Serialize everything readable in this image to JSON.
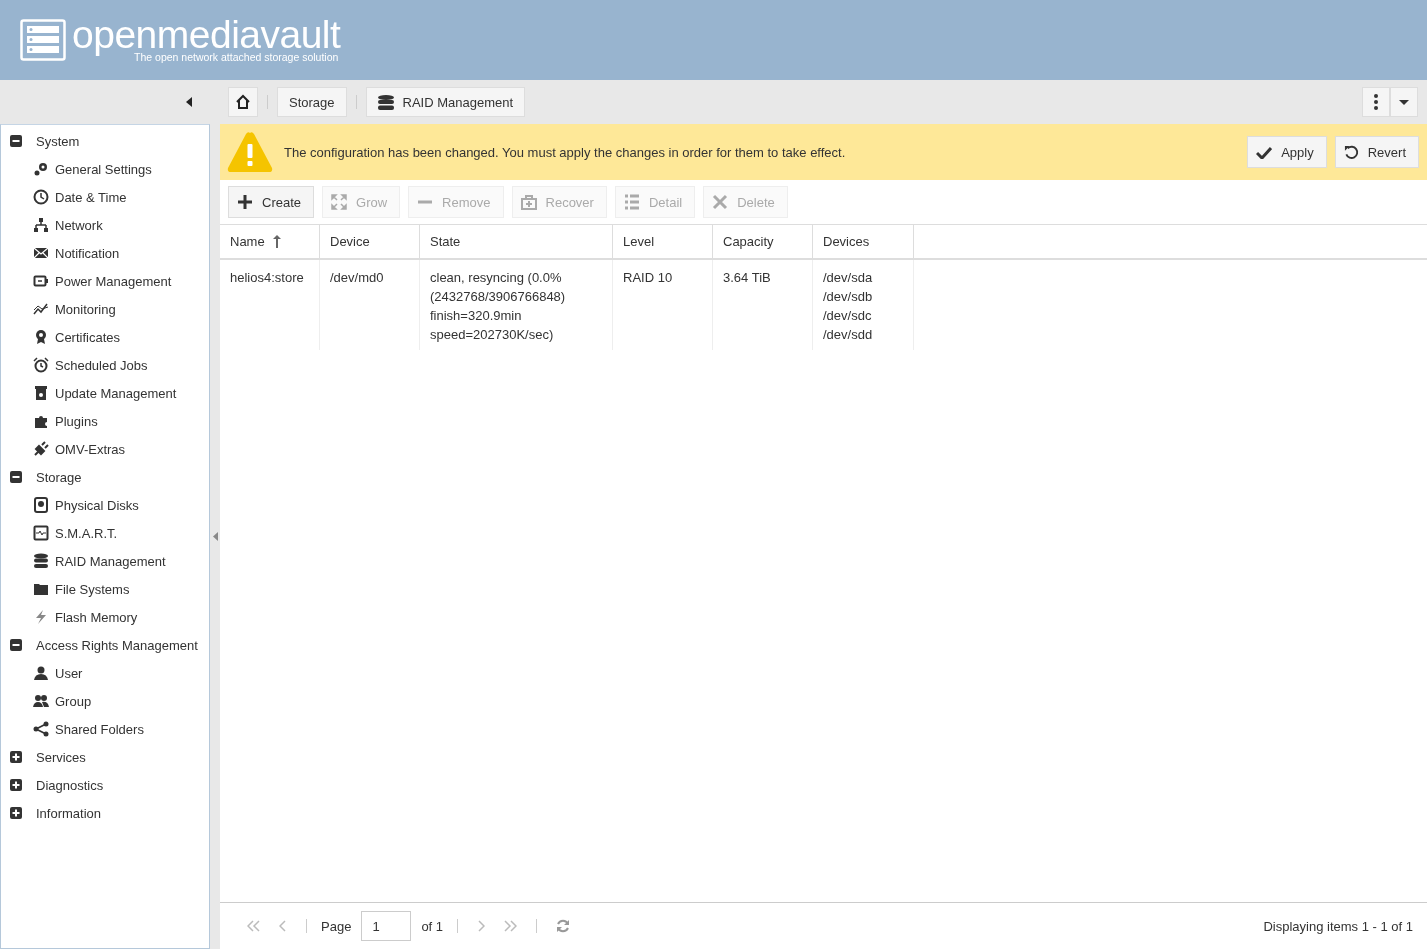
{
  "header": {
    "logo_text": "openmediavault",
    "tagline": "The open network attached storage solution"
  },
  "breadcrumb": [
    {
      "label": "Storage"
    },
    {
      "label": "RAID Management"
    }
  ],
  "sidebar": {
    "groups": [
      {
        "label": "System",
        "expanded": true,
        "children": [
          {
            "label": "General Settings"
          },
          {
            "label": "Date & Time"
          },
          {
            "label": "Network"
          },
          {
            "label": "Notification"
          },
          {
            "label": "Power Management"
          },
          {
            "label": "Monitoring"
          },
          {
            "label": "Certificates"
          },
          {
            "label": "Scheduled Jobs"
          },
          {
            "label": "Update Management"
          },
          {
            "label": "Plugins"
          },
          {
            "label": "OMV-Extras"
          }
        ]
      },
      {
        "label": "Storage",
        "expanded": true,
        "children": [
          {
            "label": "Physical Disks"
          },
          {
            "label": "S.M.A.R.T."
          },
          {
            "label": "RAID Management"
          },
          {
            "label": "File Systems"
          },
          {
            "label": "Flash Memory"
          }
        ]
      },
      {
        "label": "Access Rights Management",
        "expanded": true,
        "children": [
          {
            "label": "User"
          },
          {
            "label": "Group"
          },
          {
            "label": "Shared Folders"
          }
        ]
      },
      {
        "label": "Services",
        "expanded": false
      },
      {
        "label": "Diagnostics",
        "expanded": false
      },
      {
        "label": "Information",
        "expanded": false
      }
    ]
  },
  "notice": {
    "message": "The configuration has been changed. You must apply the changes in order for them to take effect.",
    "buttons": [
      {
        "label": "Apply"
      },
      {
        "label": "Revert"
      }
    ]
  },
  "toolbar": [
    {
      "label": "Create",
      "disabled": false
    },
    {
      "label": "Grow",
      "disabled": true
    },
    {
      "label": "Remove",
      "disabled": true
    },
    {
      "label": "Recover",
      "disabled": true
    },
    {
      "label": "Detail",
      "disabled": true
    },
    {
      "label": "Delete",
      "disabled": true
    }
  ],
  "table": {
    "columns": [
      {
        "label": "Name",
        "sorted": true
      },
      {
        "label": "Device",
        "sorted": false
      },
      {
        "label": "State",
        "sorted": false
      },
      {
        "label": "Level",
        "sorted": false
      },
      {
        "label": "Capacity",
        "sorted": false
      },
      {
        "label": "Devices",
        "sorted": false
      }
    ],
    "rows": [
      {
        "cells": [
          [
            "helios4:store"
          ],
          [
            "/dev/md0"
          ],
          [
            "clean, resyncing (0.0% (2432768/3906766848) finish=320.9min speed=202730K/sec)"
          ],
          [
            "RAID 10"
          ],
          [
            "3.64 TiB"
          ],
          [
            "/dev/sda",
            "/dev/sdb",
            "/dev/sdc",
            "/dev/sdd"
          ]
        ]
      }
    ]
  },
  "pager": {
    "page_label": "Page",
    "page": "1",
    "of": "of 1",
    "summary": "Displaying items 1 - 1 of 1"
  }
}
